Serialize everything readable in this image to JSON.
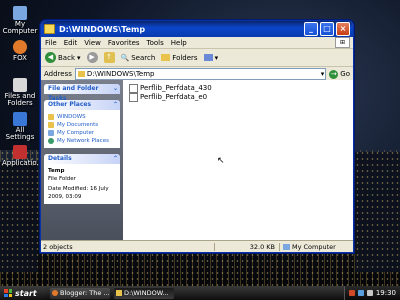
{
  "desktop": {
    "icons": [
      {
        "label": "My Computer",
        "color": "#7aa7e0"
      },
      {
        "label": "FOX",
        "color": "#e07a2a"
      },
      {
        "label": "Files and Folders",
        "color": "#d8d8d8"
      },
      {
        "label": "All Settings",
        "color": "#3a78d8"
      },
      {
        "label": "Applicatio...",
        "color": "#c23030"
      }
    ]
  },
  "window": {
    "title": "D:\\WINDOWS\\Temp",
    "menu": [
      "File",
      "Edit",
      "View",
      "Favorites",
      "Tools",
      "Help"
    ],
    "toolbar": {
      "back": "Back",
      "search": "Search",
      "folders": "Folders"
    },
    "address": {
      "label": "Address",
      "value": "D:\\WINDOWS\\Temp",
      "go": "Go"
    },
    "sidebar": {
      "tasks_header": "File and Folder Tasks",
      "other_header": "Other Places",
      "other_items": [
        "WINDOWS",
        "My Documents",
        "My Computer",
        "My Network Places"
      ],
      "details_header": "Details",
      "details": {
        "name": "Temp",
        "type": "File Folder",
        "modified": "Date Modified: 16 July 2009, 03:09"
      }
    },
    "files": [
      "Perflib_Perfdata_430",
      "Perflib_Perfdata_e0"
    ],
    "status": {
      "count": "2 objects",
      "size": "32.0 KB",
      "location": "My Computer"
    }
  },
  "taskbar": {
    "start": "start",
    "tasks": [
      "Blogger: The ...",
      "D:\\WINDOW..."
    ],
    "clock": "19:30"
  },
  "colors": {
    "accent": "#0b45c8",
    "panel_header": "#215dc6"
  }
}
